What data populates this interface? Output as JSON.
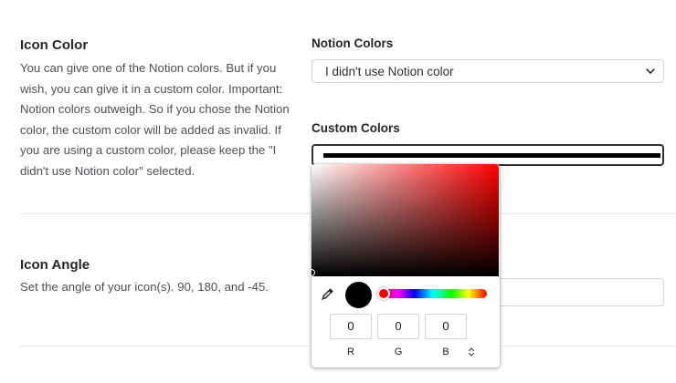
{
  "icon_color": {
    "title": "Icon Color",
    "description_lines": [
      "You can give one of the Notion colors. But if you",
      "wish, you can give it in a custom color. Important:",
      "Notion colors outweigh. So if you chose the Notion",
      "color, the custom color will be added as invalid. If",
      "you are using a custom color, please keep the \"I",
      "didn't use Notion color\" selected."
    ]
  },
  "notion_colors": {
    "label": "Notion Colors",
    "selected": "I didn't use Notion color"
  },
  "custom_colors": {
    "label": "Custom Colors",
    "value_color": "#000000"
  },
  "icon_angle": {
    "title": "Icon Angle",
    "description": "Set the angle of your icon(s). 90, 180, and -45."
  },
  "color_picker": {
    "hue_color": "#ff0000",
    "current_color": "#000000",
    "r": "0",
    "g": "0",
    "b": "0",
    "r_label": "R",
    "g_label": "G",
    "b_label": "B"
  }
}
